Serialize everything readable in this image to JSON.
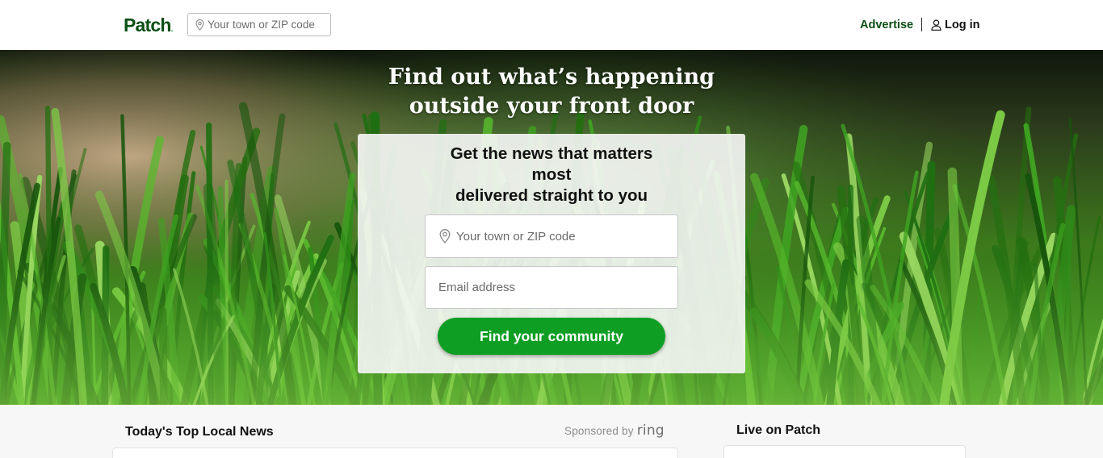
{
  "header": {
    "logo_text": "Patch",
    "logo_dot": ".",
    "search_placeholder": "Your town or ZIP code",
    "advertise_label": "Advertise",
    "login_label": "Log in"
  },
  "hero": {
    "title_line1": "Find out what’s happening",
    "title_line2": "outside your front door"
  },
  "signup": {
    "heading_line1": "Get the news that matters",
    "heading_line2": "most",
    "heading_line3": "delivered straight to you",
    "town_placeholder": "Your town or ZIP code",
    "email_placeholder": "Email address",
    "submit_label": "Find your community"
  },
  "sections": {
    "top_news_title": "Today's Top Local News",
    "sponsored_prefix": "Sponsored by",
    "sponsor_brand": "ring",
    "live_title": "Live on Patch"
  },
  "colors": {
    "brand_dark_green": "#0b4f16",
    "cta_green": "#0e9e23",
    "page_background": "#f7f7f7"
  },
  "icons": {
    "location": "map-pin-icon",
    "user": "user-icon"
  }
}
